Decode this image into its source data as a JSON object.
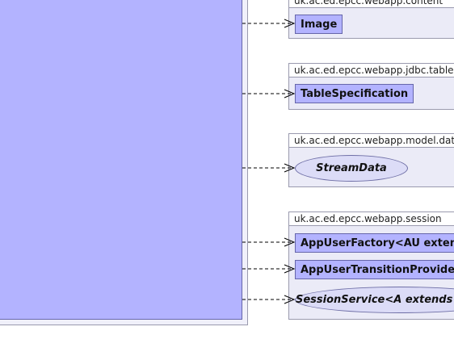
{
  "packages": [
    {
      "title": "uk.ac.ed.epcc.webapp.content",
      "items": [
        {
          "kind": "class",
          "label": "Image"
        }
      ]
    },
    {
      "title": "uk.ac.ed.epcc.webapp.jdbc.table",
      "items": [
        {
          "kind": "class",
          "label": "TableSpecification"
        }
      ]
    },
    {
      "title": "uk.ac.ed.epcc.webapp.model.data",
      "items": [
        {
          "kind": "interface",
          "label": "StreamData"
        }
      ]
    },
    {
      "title": "uk.ac.ed.epcc.webapp.session",
      "items": [
        {
          "kind": "class",
          "label": "AppUserFactory<AU extends AppUser>"
        },
        {
          "kind": "class",
          "label": "AppUserTransitionProvider"
        },
        {
          "kind": "interface",
          "label": "SessionService<A extends AppUser>"
        }
      ]
    }
  ],
  "colors": {
    "class_fill": "#b3b3ff",
    "interface_fill": "#dcdcf7",
    "package_fill": "#ebebf7",
    "connector": "#000000"
  }
}
